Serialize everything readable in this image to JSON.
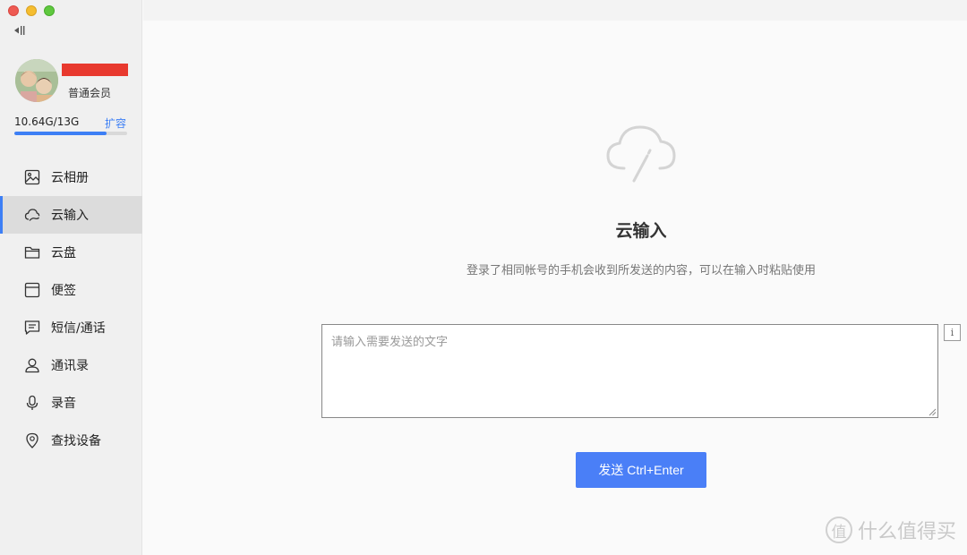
{
  "sidebar": {
    "username": "",
    "member_level": "普通会员",
    "storage_text": "10.64G/13G",
    "storage_used_fraction": 0.8185,
    "expand_label": "扩容",
    "items": [
      {
        "label": "云相册",
        "icon": "photo-album-icon"
      },
      {
        "label": "云输入",
        "icon": "cloud-input-icon",
        "active": true
      },
      {
        "label": "云盘",
        "icon": "folder-icon"
      },
      {
        "label": "便签",
        "icon": "notes-icon"
      },
      {
        "label": "短信/通话",
        "icon": "message-icon"
      },
      {
        "label": "通讯录",
        "icon": "contacts-icon"
      },
      {
        "label": "录音",
        "icon": "microphone-icon"
      },
      {
        "label": "查找设备",
        "icon": "location-pin-icon"
      }
    ]
  },
  "main": {
    "title": "云输入",
    "subtitle": "登录了相同帐号的手机会收到所发送的内容，可以在输入时粘贴使用",
    "input": {
      "placeholder": "请输入需要发送的文字",
      "value": ""
    },
    "info_label": "i",
    "send_label": "发送 Ctrl+Enter"
  },
  "watermark": {
    "logo_char": "值",
    "text": "什么值得买"
  },
  "colors": {
    "accent": "#3d7ff5",
    "button": "#4a7ff7",
    "sidebar_bg": "#f0f0f0",
    "active_bg": "#dcdcdc"
  }
}
